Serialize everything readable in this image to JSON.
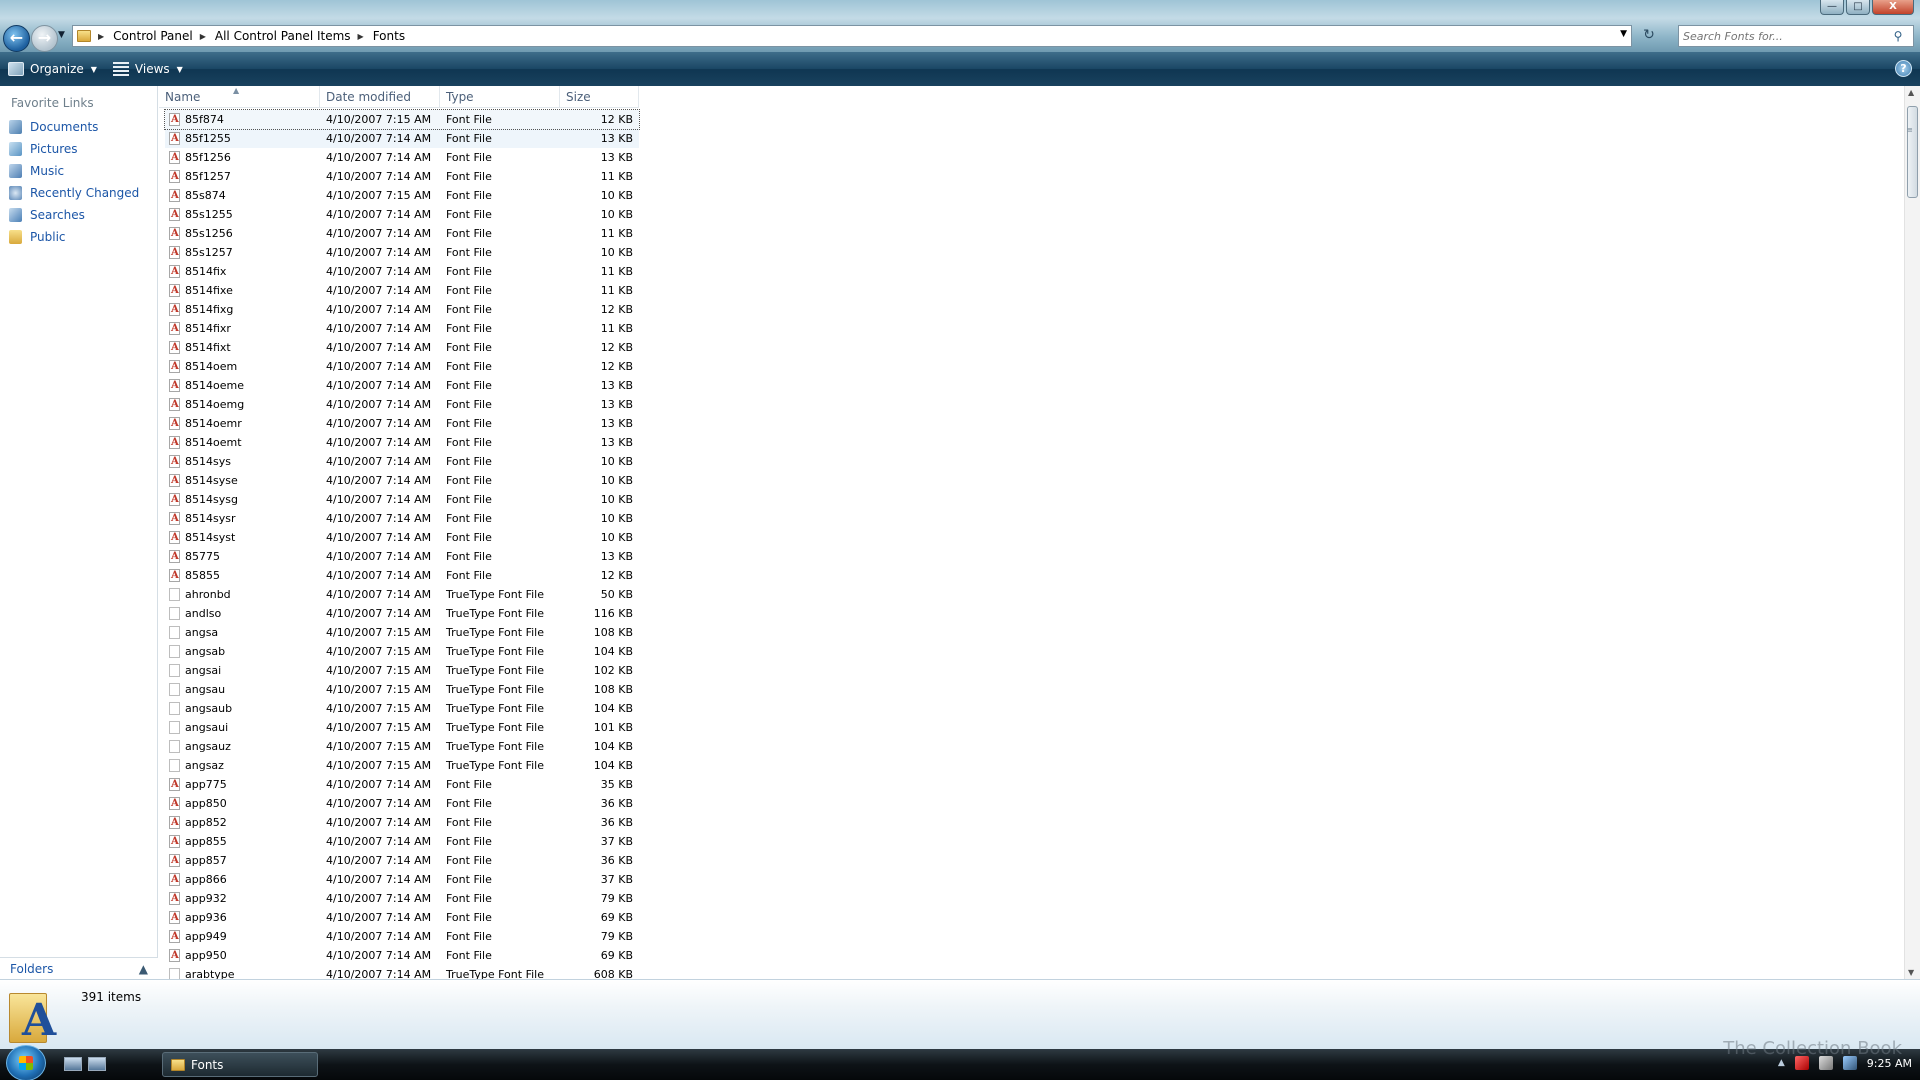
{
  "address": {
    "crumbs": [
      "Control Panel",
      "All Control Panel Items",
      "Fonts"
    ]
  },
  "search": {
    "placeholder": "Search Fonts for..."
  },
  "toolbar": {
    "organize_label": "Organize",
    "views_label": "Views",
    "help_label": "?"
  },
  "window_buttons": {
    "minimize": "—",
    "maximize": "□",
    "close": "X"
  },
  "navigation": {
    "favorites_header": "Favorite Links",
    "items": [
      {
        "label": "Documents",
        "icon": "documents-icon"
      },
      {
        "label": "Pictures",
        "icon": "pictures-icon"
      },
      {
        "label": "Music",
        "icon": "music-icon"
      },
      {
        "label": "Recently Changed",
        "icon": "recently-changed-icon"
      },
      {
        "label": "Searches",
        "icon": "searches-icon"
      },
      {
        "label": "Public",
        "icon": "public-folder-icon"
      }
    ],
    "folders_label": "Folders"
  },
  "columns": {
    "name": "Name",
    "date": "Date modified",
    "type": "Type",
    "size": "Size"
  },
  "files": [
    {
      "name": "85f874",
      "date": "4/10/2007 7:15 AM",
      "type": "Font File",
      "size": "12 KB",
      "kind": "font"
    },
    {
      "name": "85f1255",
      "date": "4/10/2007 7:14 AM",
      "type": "Font File",
      "size": "13 KB",
      "kind": "font"
    },
    {
      "name": "85f1256",
      "date": "4/10/2007 7:14 AM",
      "type": "Font File",
      "size": "13 KB",
      "kind": "font"
    },
    {
      "name": "85f1257",
      "date": "4/10/2007 7:14 AM",
      "type": "Font File",
      "size": "11 KB",
      "kind": "font"
    },
    {
      "name": "85s874",
      "date": "4/10/2007 7:15 AM",
      "type": "Font File",
      "size": "10 KB",
      "kind": "font"
    },
    {
      "name": "85s1255",
      "date": "4/10/2007 7:14 AM",
      "type": "Font File",
      "size": "10 KB",
      "kind": "font"
    },
    {
      "name": "85s1256",
      "date": "4/10/2007 7:14 AM",
      "type": "Font File",
      "size": "11 KB",
      "kind": "font"
    },
    {
      "name": "85s1257",
      "date": "4/10/2007 7:14 AM",
      "type": "Font File",
      "size": "10 KB",
      "kind": "font"
    },
    {
      "name": "8514fix",
      "date": "4/10/2007 7:14 AM",
      "type": "Font File",
      "size": "11 KB",
      "kind": "font"
    },
    {
      "name": "8514fixe",
      "date": "4/10/2007 7:14 AM",
      "type": "Font File",
      "size": "11 KB",
      "kind": "font"
    },
    {
      "name": "8514fixg",
      "date": "4/10/2007 7:14 AM",
      "type": "Font File",
      "size": "12 KB",
      "kind": "font"
    },
    {
      "name": "8514fixr",
      "date": "4/10/2007 7:14 AM",
      "type": "Font File",
      "size": "11 KB",
      "kind": "font"
    },
    {
      "name": "8514fixt",
      "date": "4/10/2007 7:14 AM",
      "type": "Font File",
      "size": "12 KB",
      "kind": "font"
    },
    {
      "name": "8514oem",
      "date": "4/10/2007 7:14 AM",
      "type": "Font File",
      "size": "12 KB",
      "kind": "font"
    },
    {
      "name": "8514oeme",
      "date": "4/10/2007 7:14 AM",
      "type": "Font File",
      "size": "13 KB",
      "kind": "font"
    },
    {
      "name": "8514oemg",
      "date": "4/10/2007 7:14 AM",
      "type": "Font File",
      "size": "13 KB",
      "kind": "font"
    },
    {
      "name": "8514oemr",
      "date": "4/10/2007 7:14 AM",
      "type": "Font File",
      "size": "13 KB",
      "kind": "font"
    },
    {
      "name": "8514oemt",
      "date": "4/10/2007 7:14 AM",
      "type": "Font File",
      "size": "13 KB",
      "kind": "font"
    },
    {
      "name": "8514sys",
      "date": "4/10/2007 7:14 AM",
      "type": "Font File",
      "size": "10 KB",
      "kind": "font"
    },
    {
      "name": "8514syse",
      "date": "4/10/2007 7:14 AM",
      "type": "Font File",
      "size": "10 KB",
      "kind": "font"
    },
    {
      "name": "8514sysg",
      "date": "4/10/2007 7:14 AM",
      "type": "Font File",
      "size": "10 KB",
      "kind": "font"
    },
    {
      "name": "8514sysr",
      "date": "4/10/2007 7:14 AM",
      "type": "Font File",
      "size": "10 KB",
      "kind": "font"
    },
    {
      "name": "8514syst",
      "date": "4/10/2007 7:14 AM",
      "type": "Font File",
      "size": "10 KB",
      "kind": "font"
    },
    {
      "name": "85775",
      "date": "4/10/2007 7:14 AM",
      "type": "Font File",
      "size": "13 KB",
      "kind": "font"
    },
    {
      "name": "85855",
      "date": "4/10/2007 7:14 AM",
      "type": "Font File",
      "size": "12 KB",
      "kind": "font"
    },
    {
      "name": "ahronbd",
      "date": "4/10/2007 7:14 AM",
      "type": "TrueType Font File",
      "size": "50 KB",
      "kind": "tt"
    },
    {
      "name": "andlso",
      "date": "4/10/2007 7:14 AM",
      "type": "TrueType Font File",
      "size": "116 KB",
      "kind": "tt"
    },
    {
      "name": "angsa",
      "date": "4/10/2007 7:15 AM",
      "type": "TrueType Font File",
      "size": "108 KB",
      "kind": "tt"
    },
    {
      "name": "angsab",
      "date": "4/10/2007 7:15 AM",
      "type": "TrueType Font File",
      "size": "104 KB",
      "kind": "tt"
    },
    {
      "name": "angsai",
      "date": "4/10/2007 7:15 AM",
      "type": "TrueType Font File",
      "size": "102 KB",
      "kind": "tt"
    },
    {
      "name": "angsau",
      "date": "4/10/2007 7:15 AM",
      "type": "TrueType Font File",
      "size": "108 KB",
      "kind": "tt"
    },
    {
      "name": "angsaub",
      "date": "4/10/2007 7:15 AM",
      "type": "TrueType Font File",
      "size": "104 KB",
      "kind": "tt"
    },
    {
      "name": "angsaui",
      "date": "4/10/2007 7:15 AM",
      "type": "TrueType Font File",
      "size": "101 KB",
      "kind": "tt"
    },
    {
      "name": "angsauz",
      "date": "4/10/2007 7:15 AM",
      "type": "TrueType Font File",
      "size": "104 KB",
      "kind": "tt"
    },
    {
      "name": "angsaz",
      "date": "4/10/2007 7:15 AM",
      "type": "TrueType Font File",
      "size": "104 KB",
      "kind": "tt"
    },
    {
      "name": "app775",
      "date": "4/10/2007 7:14 AM",
      "type": "Font File",
      "size": "35 KB",
      "kind": "font"
    },
    {
      "name": "app850",
      "date": "4/10/2007 7:14 AM",
      "type": "Font File",
      "size": "36 KB",
      "kind": "font"
    },
    {
      "name": "app852",
      "date": "4/10/2007 7:14 AM",
      "type": "Font File",
      "size": "36 KB",
      "kind": "font"
    },
    {
      "name": "app855",
      "date": "4/10/2007 7:14 AM",
      "type": "Font File",
      "size": "37 KB",
      "kind": "font"
    },
    {
      "name": "app857",
      "date": "4/10/2007 7:14 AM",
      "type": "Font File",
      "size": "36 KB",
      "kind": "font"
    },
    {
      "name": "app866",
      "date": "4/10/2007 7:14 AM",
      "type": "Font File",
      "size": "37 KB",
      "kind": "font"
    },
    {
      "name": "app932",
      "date": "4/10/2007 7:14 AM",
      "type": "Font File",
      "size": "79 KB",
      "kind": "font"
    },
    {
      "name": "app936",
      "date": "4/10/2007 7:14 AM",
      "type": "Font File",
      "size": "69 KB",
      "kind": "font"
    },
    {
      "name": "app949",
      "date": "4/10/2007 7:14 AM",
      "type": "Font File",
      "size": "79 KB",
      "kind": "font"
    },
    {
      "name": "app950",
      "date": "4/10/2007 7:14 AM",
      "type": "Font File",
      "size": "69 KB",
      "kind": "font"
    },
    {
      "name": "arabtype",
      "date": "4/10/2007 7:14 AM",
      "type": "TrueType Font File",
      "size": "608 KB",
      "kind": "tt"
    }
  ],
  "status": {
    "item_count": "391 items"
  },
  "taskbar": {
    "task_label": "Fonts",
    "clock": "9:25 AM"
  },
  "watermark": "The Collection Book"
}
